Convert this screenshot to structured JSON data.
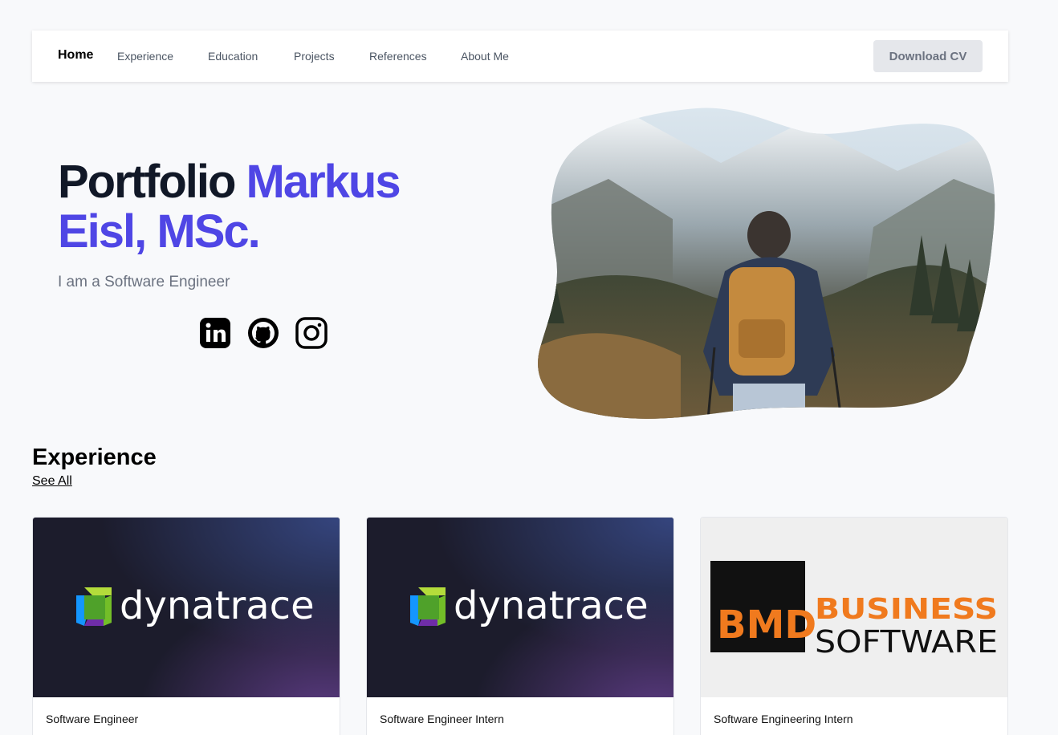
{
  "nav": {
    "items": [
      "Home",
      "Experience",
      "Education",
      "Projects",
      "References",
      "About Me"
    ],
    "download_label": "Download CV"
  },
  "hero": {
    "title_plain": "Portfolio ",
    "title_accent_1": "Markus",
    "title_accent_2": "Eisl, MSc.",
    "subtitle": "I am a Software Engineer",
    "accent_color": "#4f46e5",
    "social_icons": [
      "linkedin-icon",
      "github-icon",
      "instagram-icon"
    ],
    "image": "hiker-with-backpack-in-snowy-mountains"
  },
  "experience": {
    "heading": "Experience",
    "see_all": "See All",
    "cards": [
      {
        "title": "Software Engineer",
        "logo_text": "dynatrace"
      },
      {
        "title": "Software Engineer Intern",
        "logo_text": "dynatrace"
      },
      {
        "title": "Software Engineering Intern",
        "logo_line_1": "BUSINESS",
        "logo_line_2": "SOFTWARE",
        "logo_mark": "BMD"
      }
    ]
  }
}
